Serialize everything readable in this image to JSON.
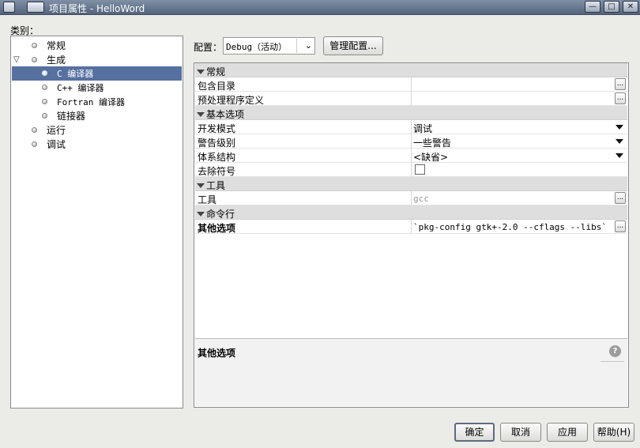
{
  "window": {
    "title": "项目属性 - HelloWord",
    "controls": {
      "minimize": "—",
      "maximize": "□",
      "close": "✕"
    }
  },
  "category_label": "类别：",
  "tree": {
    "items": [
      {
        "label": "常规",
        "selected": false
      },
      {
        "label": "生成",
        "selected": false,
        "expanded": true
      },
      {
        "label": "C 编译器",
        "selected": true
      },
      {
        "label": "C++ 编译器",
        "selected": false
      },
      {
        "label": "Fortran 编译器",
        "selected": false
      },
      {
        "label": "链接器",
        "selected": false
      },
      {
        "label": "运行",
        "selected": false
      },
      {
        "label": "调试",
        "selected": false
      }
    ]
  },
  "config": {
    "label": "配置：",
    "value": "Debug（活动）",
    "manage_button": "管理配置..."
  },
  "sheet": {
    "sections": [
      {
        "title": "常规",
        "rows": [
          {
            "name": "包含目录",
            "value": "",
            "editor": "ellipsis"
          },
          {
            "name": "预处理程序定义",
            "value": "",
            "editor": "ellipsis"
          }
        ]
      },
      {
        "title": "基本选项",
        "rows": [
          {
            "name": "开发模式",
            "value": "调试",
            "editor": "dropdown"
          },
          {
            "name": "警告级别",
            "value": "一些警告",
            "editor": "dropdown"
          },
          {
            "name": "体系结构",
            "value": "<缺省>",
            "editor": "dropdown"
          },
          {
            "name": "去除符号",
            "value": "",
            "editor": "checkbox"
          }
        ]
      },
      {
        "title": "工具",
        "rows": [
          {
            "name": "工具",
            "value": "gcc",
            "editor": "ellipsis"
          }
        ]
      },
      {
        "title": "命令行",
        "rows": [
          {
            "name": "其他选项",
            "value": "`pkg-config gtk+-2.0 --cflags --libs`",
            "editor": "ellipsis"
          }
        ]
      }
    ],
    "ellipsis_label": "...",
    "description_title": "其他选项",
    "help_icon": "?"
  },
  "buttons": {
    "ok": "确定",
    "cancel": "取消",
    "apply": "应用",
    "help": "帮助(H)"
  },
  "colors": {
    "selection": "#5670a0",
    "titlebar": "#6a7a92"
  }
}
